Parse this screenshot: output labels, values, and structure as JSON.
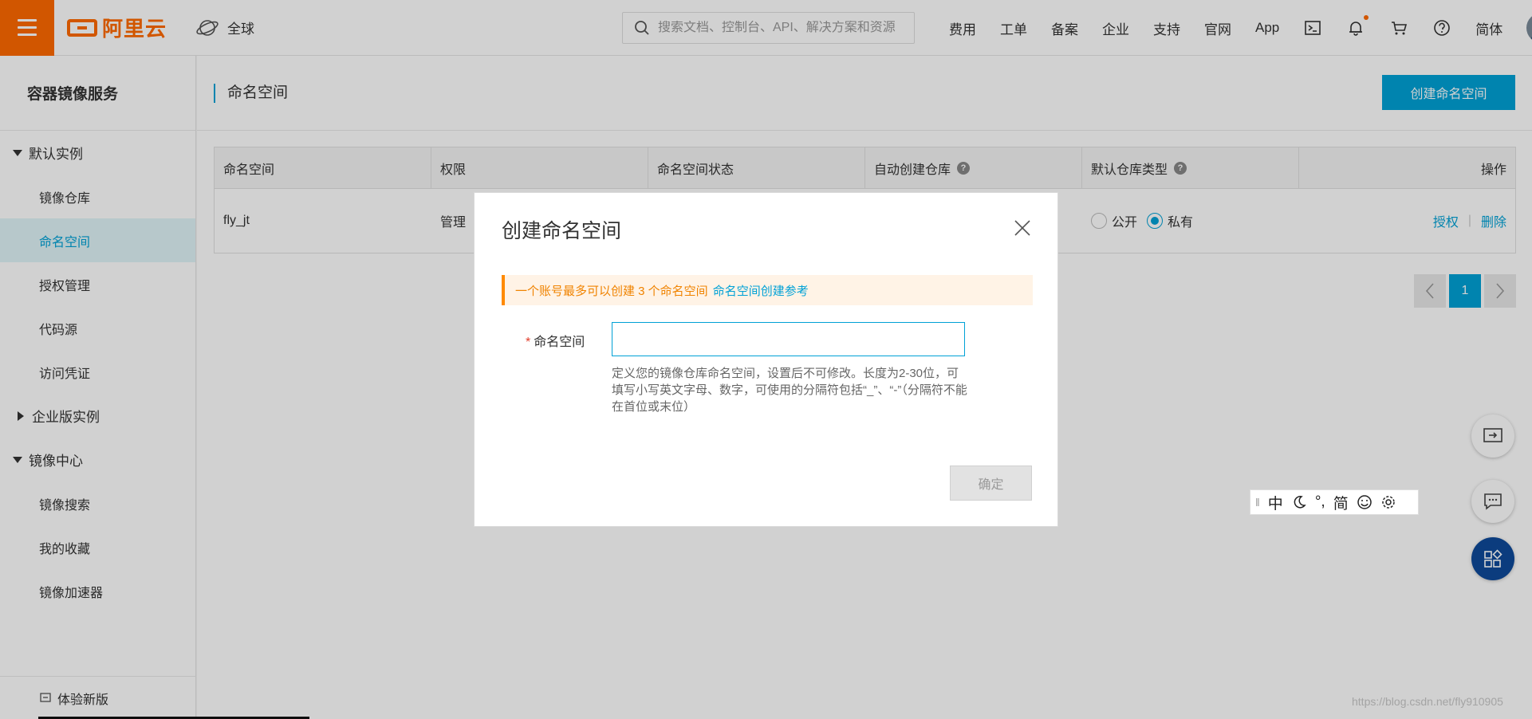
{
  "header": {
    "logo_text": "阿里云",
    "region": "全球",
    "search_placeholder": "搜索文档、控制台、API、解决方案和资源",
    "nav": [
      "费用",
      "工单",
      "备案",
      "企业",
      "支持",
      "官网",
      "App"
    ],
    "lang": "简体"
  },
  "sidebar": {
    "title": "容器镜像服务",
    "groups": [
      {
        "label": "默认实例",
        "expanded": true,
        "items": [
          "镜像仓库",
          "命名空间",
          "授权管理",
          "代码源",
          "访问凭证"
        ]
      },
      {
        "label": "企业版实例",
        "expanded": false,
        "items": []
      },
      {
        "label": "镜像中心",
        "expanded": true,
        "items": [
          "镜像搜索",
          "我的收藏",
          "镜像加速器"
        ]
      }
    ],
    "active_item": "命名空间",
    "footer": "体验新版"
  },
  "main": {
    "page_title": "命名空间",
    "create_button": "创建命名空间",
    "table": {
      "headers": [
        "命名空间",
        "权限",
        "命名空间状态",
        "自动创建仓库",
        "默认仓库类型",
        "操作"
      ],
      "rows": [
        {
          "name": "fly_jt",
          "permission": "管理",
          "repo_public": "公开",
          "repo_private": "私有",
          "default_repo_type": "私有",
          "action_authorize": "授权",
          "action_delete": "删除"
        }
      ]
    },
    "pagination": {
      "current_page": "1"
    }
  },
  "modal": {
    "title": "创建命名空间",
    "notice_text": "一个账号最多可以创建 3 个命名空间",
    "notice_link": "命名空间创建参考",
    "field_label": "命名空间",
    "required_mark": "*",
    "input_value": "",
    "hint": "定义您的镜像仓库命名空间，设置后不可修改。长度为2-30位，可填写小写英文字母、数字，可使用的分隔符包括“_”、“-”（分隔符不能在首位或末位）",
    "confirm_button": "确定"
  },
  "ime": {
    "items": [
      "中",
      "°,",
      "简"
    ]
  },
  "watermark": "https://blog.csdn.net/fly910905",
  "colors": {
    "brand": "#ff6a00",
    "accent": "#00a1d6",
    "notice_bg": "#fff3e6",
    "notice_text": "#f08300"
  }
}
